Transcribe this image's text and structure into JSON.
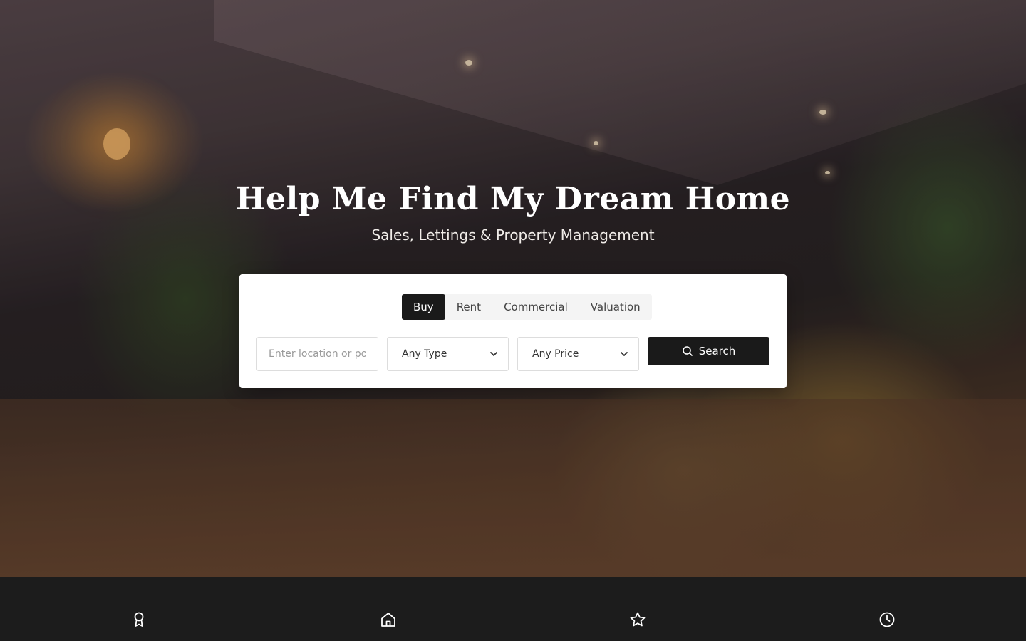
{
  "hero": {
    "title": "Help Me Find My Dream Home",
    "subtitle": "Sales, Lettings & Property Management"
  },
  "search": {
    "tabs": [
      {
        "label": "Buy",
        "active": true
      },
      {
        "label": "Rent",
        "active": false
      },
      {
        "label": "Commercial",
        "active": false
      },
      {
        "label": "Valuation",
        "active": false
      }
    ],
    "location_placeholder": "Enter location or postcode",
    "location_value": "",
    "type_selected": "Any Type",
    "price_selected": "Any Price",
    "button_label": "Search"
  },
  "features": {
    "icons": [
      "award-icon",
      "home-icon",
      "star-icon",
      "clock-icon"
    ]
  },
  "colors": {
    "accent": "#1a1a1a",
    "card": "#ffffff",
    "footer_band": "#1c1c1c"
  }
}
